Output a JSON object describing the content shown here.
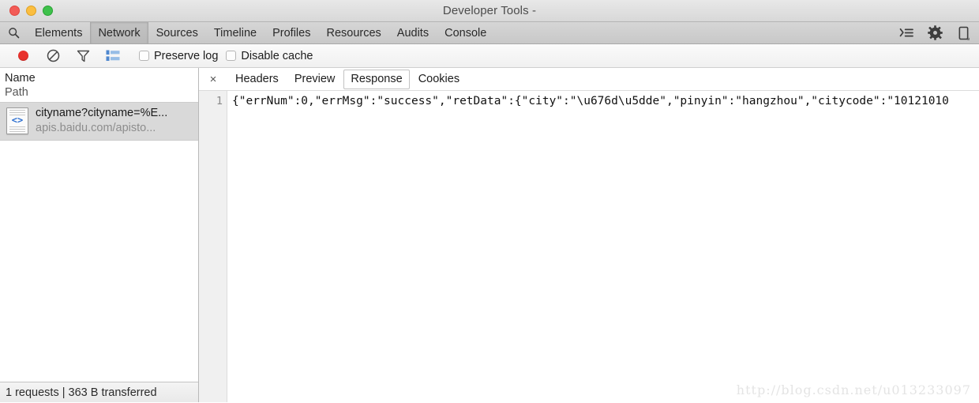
{
  "titlebar": {
    "title": "Developer Tools -",
    "buttons": [
      "close-button",
      "minimize-button",
      "zoom-button"
    ]
  },
  "panelbar": {
    "search_icon": "search-icon",
    "tabs": [
      {
        "label": "Elements",
        "selected": false
      },
      {
        "label": "Network",
        "selected": true
      },
      {
        "label": "Sources",
        "selected": false
      },
      {
        "label": "Timeline",
        "selected": false
      },
      {
        "label": "Profiles",
        "selected": false
      },
      {
        "label": "Resources",
        "selected": false
      },
      {
        "label": "Audits",
        "selected": false
      },
      {
        "label": "Console",
        "selected": false
      }
    ],
    "right_buttons": [
      "drawer-console-icon",
      "gear-icon",
      "dock-position-icon"
    ]
  },
  "toolbar": {
    "record_button": "record-button",
    "clear_button": "clear-button",
    "filter_button": "filter-button",
    "view_list_button": "view-list-button",
    "checkboxes": [
      {
        "label": "Preserve log",
        "checked": false
      },
      {
        "label": "Disable cache",
        "checked": false
      }
    ]
  },
  "request_panel": {
    "columns": {
      "name": "Name",
      "path": "Path"
    },
    "rows": [
      {
        "name": "cityname?cityname=%E...",
        "path": "apis.baidu.com/apisto...",
        "icon": "document-code-icon",
        "selected": true
      }
    ],
    "status": "1 requests | 363 B transferred"
  },
  "detail_panel": {
    "close_label": "×",
    "tabs": [
      {
        "label": "Headers",
        "selected": false
      },
      {
        "label": "Preview",
        "selected": false
      },
      {
        "label": "Response",
        "selected": true
      },
      {
        "label": "Cookies",
        "selected": false
      }
    ],
    "line_number": "1",
    "response_body": "{\"errNum\":0,\"errMsg\":\"success\",\"retData\":{\"city\":\"\\u676d\\u5dde\",\"pinyin\":\"hangzhou\",\"citycode\":\"10121010"
  },
  "watermark": {
    "text": "http://blog.csdn.net/u013233097"
  },
  "colors": {
    "record_red": "#e8322d",
    "accent_blue": "#2d6fd0",
    "selected_row": "#d9d9d9",
    "titlebar": "#e0e0e0"
  }
}
